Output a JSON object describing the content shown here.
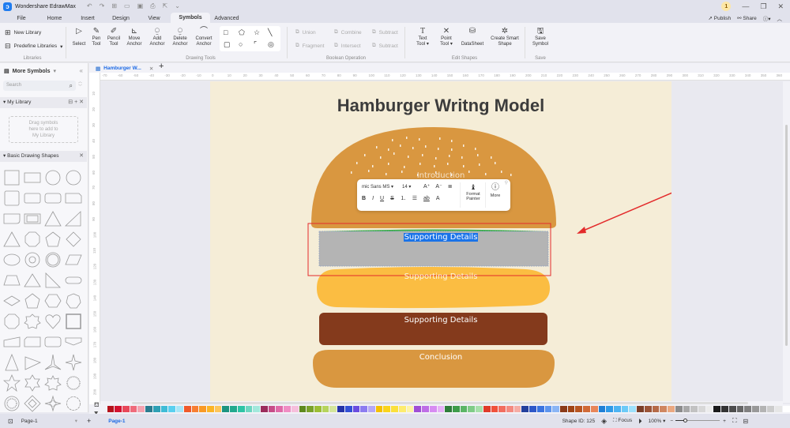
{
  "app": {
    "title": "Wondershare EdrawMax",
    "notification_count": "1"
  },
  "menu": {
    "items": [
      "File",
      "Home",
      "Insert",
      "Design",
      "View",
      "Symbols",
      "Advanced"
    ],
    "active": "Symbols",
    "publish": "Publish",
    "share": "Share"
  },
  "ribbon": {
    "libraries": {
      "new_library": "New Library",
      "predefine_libraries": "Predefine Libraries",
      "label": "Libraries"
    },
    "drawing_tools": {
      "select": "Select",
      "pen_tool": [
        "Pen",
        "Tool"
      ],
      "pencil_tool": [
        "Pencil",
        "Tool"
      ],
      "move_anchor": [
        "Move",
        "Anchor"
      ],
      "add_anchor": [
        "Add",
        "Anchor"
      ],
      "delete_anchor": [
        "Delete",
        "Anchor"
      ],
      "convert_anchor": [
        "Convert",
        "Anchor"
      ],
      "label": "Drawing Tools"
    },
    "boolean": {
      "union": "Union",
      "combine": "Combine",
      "subtract1": "Subtract",
      "fragment": "Fragment",
      "intersect": "Intersect",
      "subtract2": "Subtract",
      "label": "Boolean Operation"
    },
    "edit_shapes": {
      "text_tool": [
        "Text",
        "Tool"
      ],
      "point_tool": [
        "Point",
        "Tool"
      ],
      "datasheet": "DataSheet",
      "create_smart_shape": [
        "Create Smart",
        "Shape"
      ],
      "label": "Edit Shapes"
    },
    "save": {
      "save_symbol": [
        "Save",
        "Symbol"
      ],
      "label": "Save"
    }
  },
  "sidebar": {
    "title": "More Symbols",
    "search_placeholder": "Search",
    "my_library": "My Library",
    "dropzone": [
      "Drag symbols",
      "here to add to",
      "My Library"
    ],
    "basic_shapes": "Basic Drawing Shapes"
  },
  "tab": {
    "name": "Hamburger W..."
  },
  "ruler": {
    "h": [
      "-70",
      "-60",
      "-50",
      "-40",
      "-30",
      "-20",
      "-10",
      "0",
      "10",
      "20",
      "30",
      "40",
      "50",
      "60",
      "70",
      "80",
      "90",
      "100",
      "110",
      "120",
      "130",
      "140",
      "150",
      "160",
      "170",
      "180",
      "190",
      "200",
      "210",
      "220",
      "230",
      "240",
      "250",
      "260",
      "270",
      "280",
      "290",
      "300",
      "310",
      "320",
      "330",
      "340",
      "350",
      "360"
    ],
    "v": [
      "10",
      "20",
      "30",
      "40",
      "50",
      "60",
      "70",
      "80",
      "90",
      "100",
      "110",
      "120",
      "130",
      "140",
      "150",
      "160",
      "170",
      "180",
      "190",
      "200"
    ]
  },
  "diagram": {
    "title": "Hamburger Writng Model",
    "layers": [
      "Introduction",
      "Supporting Details",
      "Supporting Details",
      "Supporting Details",
      "Conclusion"
    ]
  },
  "format_toolbar": {
    "font": "mic Sans MS",
    "size": "14",
    "format_painter": [
      "Format",
      "Painter"
    ],
    "more": "More"
  },
  "palette": [
    "#b5121b",
    "#d3122f",
    "#e8485a",
    "#ef6b7b",
    "#f4a3b0",
    "#2a7c8f",
    "#2ea0b4",
    "#3fbcd6",
    "#5ad0ef",
    "#a6e6f7",
    "#f05a2a",
    "#f77f33",
    "#f99a25",
    "#fbb526",
    "#fdc65a",
    "#1b9480",
    "#22a98e",
    "#2ec4a5",
    "#6dd6c1",
    "#a2e8dc",
    "#9b2c5c",
    "#c74c88",
    "#e06aa8",
    "#f08dc4",
    "#f6bfdc",
    "#5e8a1e",
    "#7aa22a",
    "#9cbe34",
    "#b6d45c",
    "#d3e59b",
    "#2432a8",
    "#3350d6",
    "#6a4de0",
    "#8c7cf0",
    "#b5a8f6",
    "#f5c000",
    "#fad41c",
    "#fbe03c",
    "#fdec6e",
    "#fdf4a4",
    "#9f4ed6",
    "#be6ee6",
    "#d78cf2",
    "#e6b0f7",
    "#2e7d3a",
    "#3e9c4a",
    "#5bb566",
    "#7fcc87",
    "#a6e0aa",
    "#e03a2a",
    "#f0513b",
    "#f26d5f",
    "#f48a80",
    "#f6aca4",
    "#233f9c",
    "#2d57c8",
    "#3a73e0",
    "#5c94ee",
    "#8ab5f5",
    "#8a3a1a",
    "#a04416",
    "#b85522",
    "#d06a38",
    "#e8865a",
    "#1e7fd6",
    "#2e9ae8",
    "#4cb3f2",
    "#6ccaf7",
    "#9de0fb",
    "#7a3e28",
    "#9b5438",
    "#b56a48",
    "#cf8660",
    "#eaa880",
    "#8c8c8c",
    "#a8a8a8",
    "#c2c2c2",
    "#d8d8d8",
    "#ececec",
    "#1a1a1a",
    "#333333",
    "#4d4d4d",
    "#666666",
    "#808080",
    "#999999",
    "#b3b3b3",
    "#cccccc",
    "#e6e6e6",
    "#ffffff"
  ],
  "status": {
    "page_selector": "Page-1",
    "page_tab": "Page-1",
    "shape_id": "Shape ID: 125",
    "focus": "Focus",
    "zoom": "100%"
  },
  "colors": {
    "bun": "#d99740",
    "cheese": "#fbbd42",
    "patty": "#843a1c",
    "selection_gray": "#b4b4b4",
    "annotation_red": "#e32b2b",
    "page_bg": "#f5edd7",
    "accent": "#1d6ae5"
  }
}
